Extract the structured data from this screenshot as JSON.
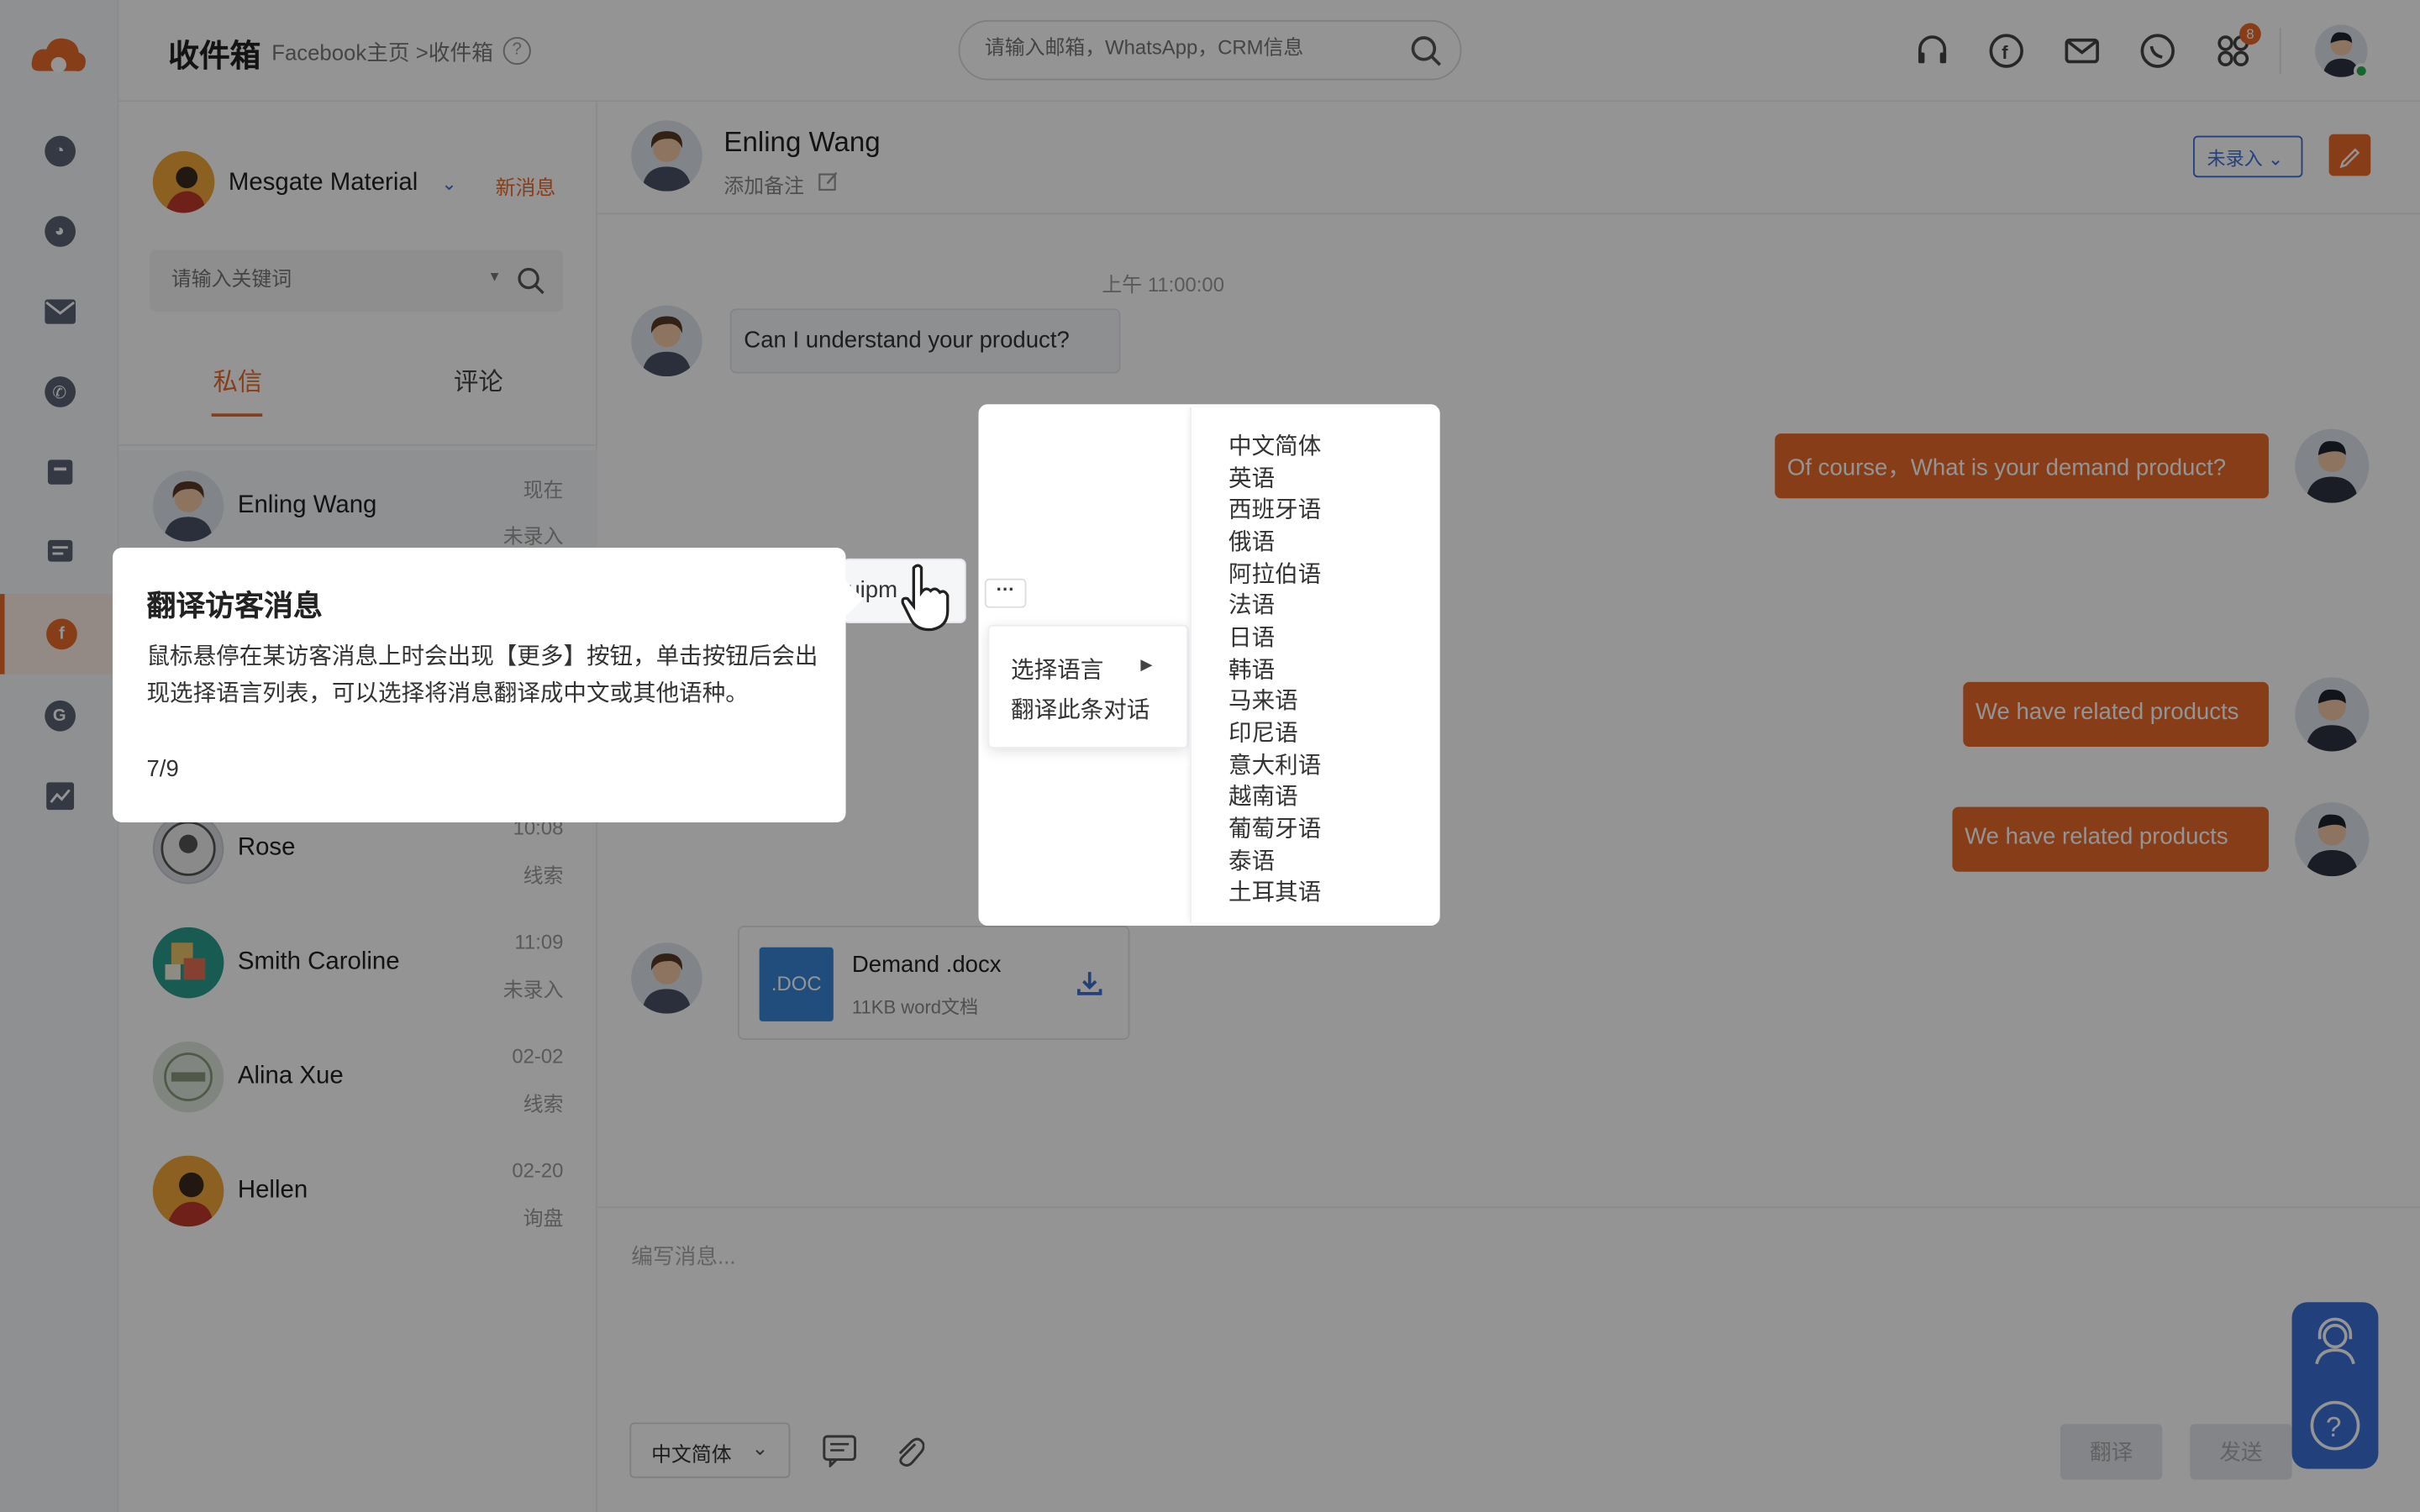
{
  "topbar": {
    "title": "收件箱",
    "breadcrumb": "Facebook主页 >收件箱",
    "search_placeholder": "请输入邮箱，WhatsApp，CRM信息",
    "notification_count": "8"
  },
  "sidebar_list": {
    "account_name": "Mesgate Material",
    "new_message": "新消息",
    "keyword_placeholder": "请输入关键词",
    "tabs": [
      "私信",
      "评论"
    ],
    "conversations": [
      {
        "name": "Enling Wang",
        "time": "现在",
        "tag": "未录入"
      },
      {
        "name": "Rose",
        "time": "10:08",
        "tag": "线索"
      },
      {
        "name": "Smith Caroline",
        "time": "11:09",
        "tag": "未录入"
      },
      {
        "name": "Alina Xue",
        "time": "02-02",
        "tag": "线索"
      },
      {
        "name": "Hellen",
        "time": "02-20",
        "tag": "询盘"
      }
    ]
  },
  "chat": {
    "contact_name": "Enling Wang",
    "add_remark": "添加备注",
    "status": "未录入",
    "timestamp": "上午 11:00:00",
    "messages": {
      "in1": "Can I understand your product?",
      "out1": "Of course，What is your demand product?",
      "in2_partial": "uipm",
      "out2": "We have related products",
      "out3": "We have related products"
    },
    "file": {
      "tag": ".DOC",
      "name": "Demand .docx",
      "meta": "11KB  word文档"
    },
    "compose_placeholder": "编写消息...",
    "language": "中文简体",
    "translate_btn": "翻译",
    "send_btn": "发送"
  },
  "menu": {
    "more": "···",
    "items": [
      "选择语言",
      "翻译此条对话"
    ],
    "languages": [
      "中文简体",
      "英语",
      "西班牙语",
      "俄语",
      "阿拉伯语",
      "法语",
      "日语",
      "韩语",
      "马来语",
      "印尼语",
      "意大利语",
      "越南语",
      "葡萄牙语",
      "泰语",
      "土耳其语"
    ]
  },
  "tooltip": {
    "title": "翻译访客消息",
    "body": "鼠标悬停在某访客消息上时会出现【更多】按钮，单击按钮后会出现选择语言列表，可以选择将消息翻译成中文或其他语种。",
    "step": "7/9"
  },
  "colors": {
    "accent": "#e8692a",
    "blue": "#3a6fd6"
  }
}
